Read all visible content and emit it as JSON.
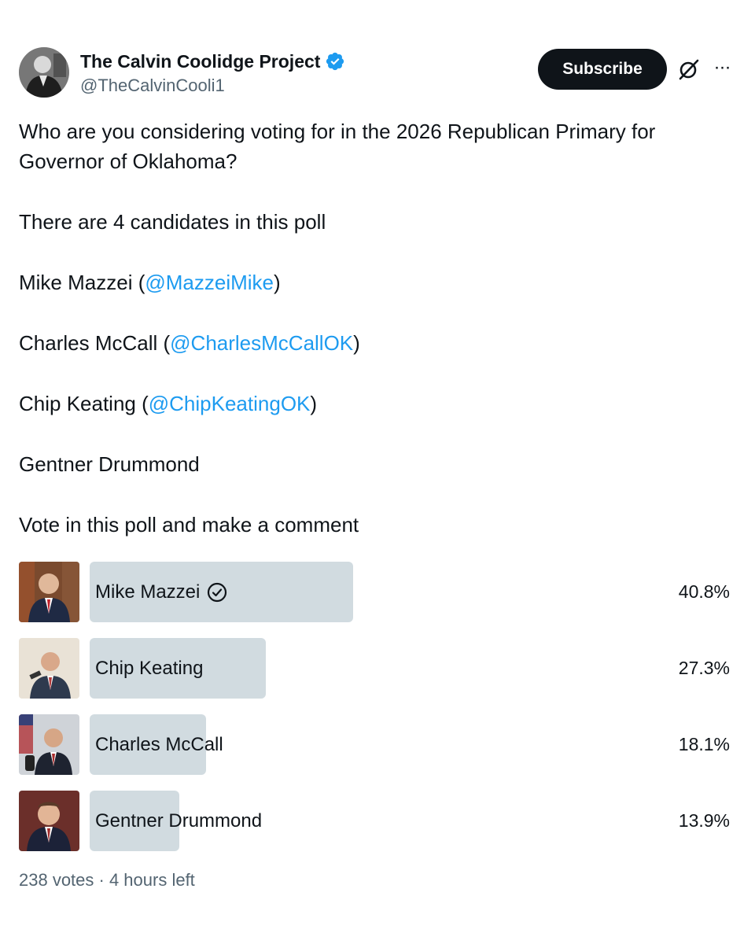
{
  "author": {
    "display_name": "The Calvin Coolidge Project",
    "handle": "@TheCalvinCooli1",
    "verified_color": "#1d9bf0"
  },
  "actions": {
    "subscribe_label": "Subscribe",
    "grok_icon": "grok-icon",
    "more_label": "···"
  },
  "post": {
    "question": "Who are you considering voting for in the 2026 Republican Primary for Governor of Oklahoma?",
    "intro": "There are 4 candidates in this poll",
    "candidates": [
      {
        "name": "Mike Mazzei (",
        "mention": "@MazzeiMike",
        "close": ")"
      },
      {
        "name": "Charles McCall (",
        "mention": "@CharlesMcCallOK",
        "close": ")"
      },
      {
        "name": "Chip Keating (",
        "mention": "@ChipKeatingOK",
        "close": ")"
      },
      {
        "name": "Gentner Drummond",
        "mention": "",
        "close": ""
      }
    ],
    "cta": "Vote in this poll and make a comment"
  },
  "poll": {
    "options": [
      {
        "label": "Mike Mazzei",
        "percent_text": "40.8%",
        "percent": 40.8,
        "winner": true
      },
      {
        "label": "Chip Keating",
        "percent_text": "27.3%",
        "percent": 27.3,
        "winner": false
      },
      {
        "label": "Charles McCall",
        "percent_text": "18.1%",
        "percent": 18.1,
        "winner": false
      },
      {
        "label": "Gentner Drummond",
        "percent_text": "13.9%",
        "percent": 13.9,
        "winner": false
      }
    ],
    "footer": "238 votes · 4 hours left"
  },
  "colors": {
    "accent": "#1d9bf0",
    "bar": "#cfd9de",
    "muted": "#536471"
  }
}
